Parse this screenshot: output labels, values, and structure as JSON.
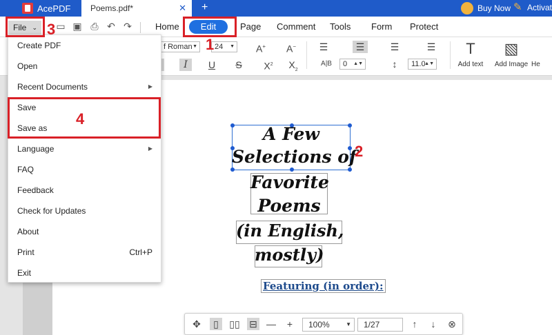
{
  "titlebar": {
    "app_name": "AcePDF",
    "doc_tab": "Poems.pdf*",
    "close": "✕",
    "new_tab": "+",
    "buy_now": "Buy Now",
    "activate": "Activat"
  },
  "menubar": {
    "file_label": "File",
    "items": [
      {
        "label": "Home"
      },
      {
        "label": "Edit"
      },
      {
        "label": "Page"
      },
      {
        "label": "Comment"
      },
      {
        "label": "Tools"
      },
      {
        "label": "Form"
      },
      {
        "label": "Protect"
      }
    ],
    "accent": "#1f6fe0"
  },
  "ribbon": {
    "font_name": "f Roman",
    "font_size": "24",
    "char_spacing": "0",
    "line_spacing": "11.0",
    "add_text": "Add text",
    "add_image": "Add Image",
    "more": "He"
  },
  "file_menu": {
    "items": [
      {
        "label": "Create PDF"
      },
      {
        "label": "Open"
      },
      {
        "label": "Recent Documents",
        "submenu": true
      },
      {
        "label": "Save"
      },
      {
        "label": "Save as"
      },
      {
        "label": "Language",
        "submenu": true
      },
      {
        "label": "FAQ"
      },
      {
        "label": "Feedback"
      },
      {
        "label": "Check for Updates"
      },
      {
        "label": "About"
      },
      {
        "label": "Print",
        "shortcut": "Ctrl+P"
      },
      {
        "label": "Exit"
      }
    ]
  },
  "document": {
    "lines": [
      "A Few",
      "Selections of",
      "Favorite",
      "Poems",
      "(in English,",
      "mostly)"
    ],
    "featuring": "Featuring (in order):"
  },
  "bottom_bar": {
    "zoom": "100%",
    "page": "1/27"
  },
  "annotations": {
    "n1": "1",
    "n2": "2",
    "n3": "3",
    "n4": "4",
    "color": "#d92027"
  }
}
